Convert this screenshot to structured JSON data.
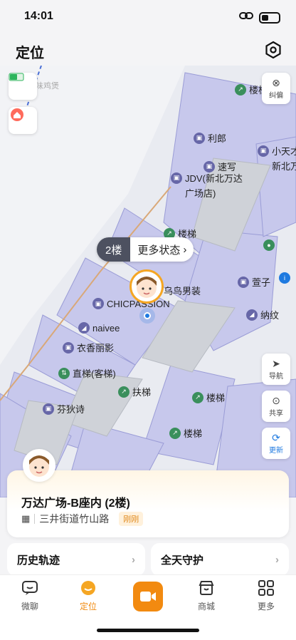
{
  "status_bar": {
    "time": "14:01"
  },
  "header": {
    "title": "定位"
  },
  "map": {
    "pois": {
      "louti_top": "楼梯",
      "lilang": "利郎",
      "suxie": "速写",
      "jdv_line1": "JDV(新北万达",
      "jdv_line2": "广场店)",
      "xiaotiancai_line1": "小天才",
      "xiaotiancai_line2": "新北万",
      "louti_mid": "楼梯",
      "niao_nanzhuang": "乌鸟男装",
      "chicpassion": "CHICPASSION",
      "xuanzi": "萱子",
      "naiwen": "纳纹",
      "naivee": "naivee",
      "yixiang": "衣香丽影",
      "zhiti": "直梯(客梯)",
      "futi": "扶梯",
      "fendishi": "芬狄诗",
      "louti_low": "楼梯",
      "louti_low2": "楼梯",
      "faint_top": "味鸡煲"
    },
    "buttons": {
      "correct": "纠偏",
      "navigate": "导航",
      "share": "共享",
      "refresh": "更新"
    },
    "floor_label": "2楼",
    "more_status": "更多状态"
  },
  "location_card": {
    "title": "万达广场-B座内 (2楼)",
    "address": "三井街道竹山路",
    "time_badge": "刚刚"
  },
  "actions": {
    "history": "历史轨迹",
    "guard": "全天守护"
  },
  "tabbar": {
    "chat": "微聊",
    "location": "定位",
    "mall": "商城",
    "more": "更多"
  },
  "colors": {
    "accent": "#f28a10",
    "building": "#c7c8ec",
    "building_stroke": "#9a9cd6"
  }
}
